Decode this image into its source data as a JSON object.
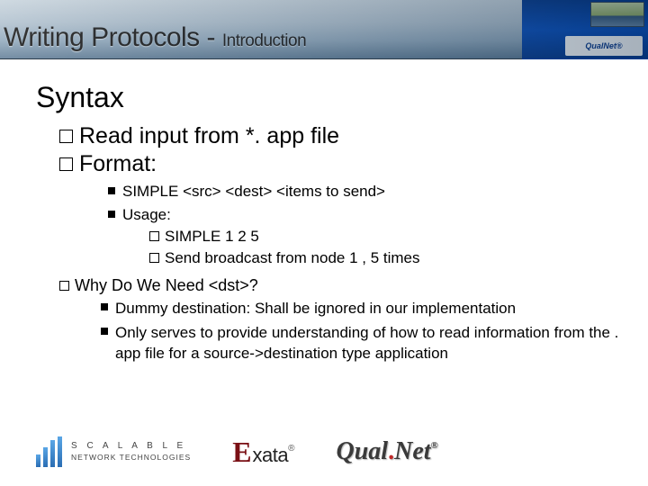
{
  "header": {
    "title_main": "Writing Protocols",
    "title_sep": " - ",
    "title_sub": "Introduction",
    "corner_logo": "QualNet®"
  },
  "content": {
    "heading": "Syntax",
    "b1": "Read input from *. app file",
    "b2": "Format:",
    "b2_1": "SIMPLE <src> <dest> <items to send>",
    "b2_2": "Usage:",
    "b2_2_1": "SIMPLE 1 2 5",
    "b2_2_2": "Send broadcast from node 1 , 5 times",
    "b3": "Why Do We Need <dst>?",
    "b3_1": "Dummy destination: Shall be ignored in our implementation",
    "b3_2": "Only serves to provide understanding of how to read information from the . app file for a source->destination type application"
  },
  "footer": {
    "snt_line1": "S C A L A B L E",
    "snt_line2": "NETWORK TECHNOLOGIES",
    "exata_e": "E",
    "exata_rest": "xata",
    "reg": "®",
    "qualnet_a": "Qual",
    "qualnet_dot": ".",
    "qualnet_b": "Net"
  }
}
